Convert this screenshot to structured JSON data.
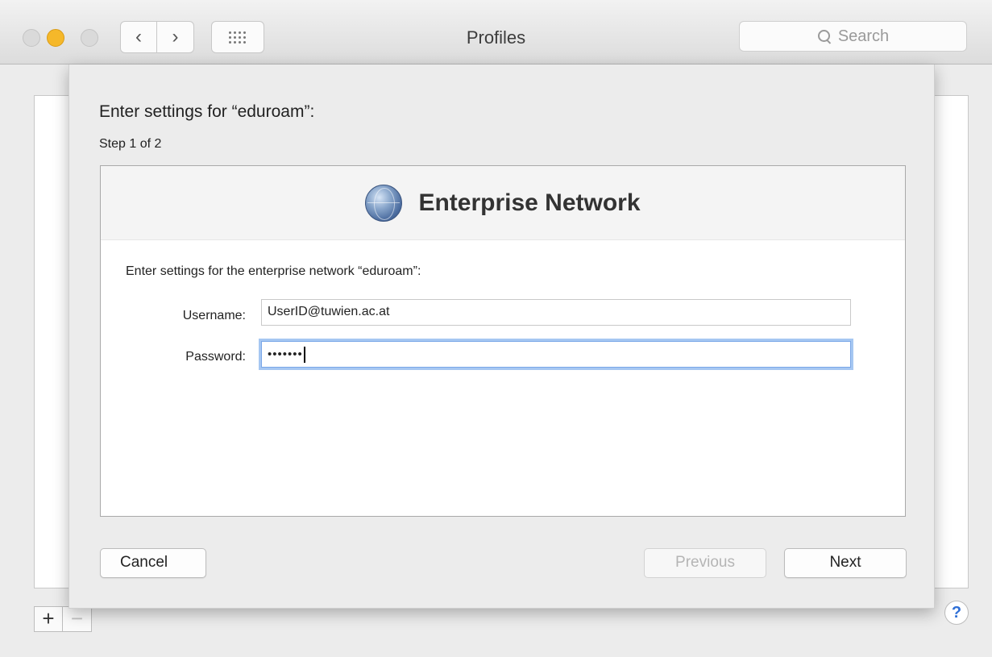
{
  "window": {
    "title": "Profiles",
    "search_placeholder": "Search"
  },
  "toolbar": {
    "back_icon": "chevron-left-icon",
    "forward_icon": "chevron-right-icon",
    "grid_icon": "grid-icon"
  },
  "sheet": {
    "title": "Enter settings for “eduroam”:",
    "step": "Step 1 of 2",
    "panel_title": "Enterprise Network",
    "panel_icon": "globe-icon",
    "description": "Enter settings for the enterprise network “eduroam”:",
    "username_label": "Username:",
    "username_value": "UserID@tuwien.ac.at",
    "password_label": "Password:",
    "password_value": "•••••••",
    "cancel_label": "Cancel",
    "previous_label": "Previous",
    "next_label": "Next"
  },
  "footer": {
    "plus_label": "+",
    "minus_label": "−",
    "help_label": "?"
  },
  "colors": {
    "accent": "#2f6fd6",
    "focus_ring": "#a6c7f2",
    "minimize": "#f5b82a"
  }
}
